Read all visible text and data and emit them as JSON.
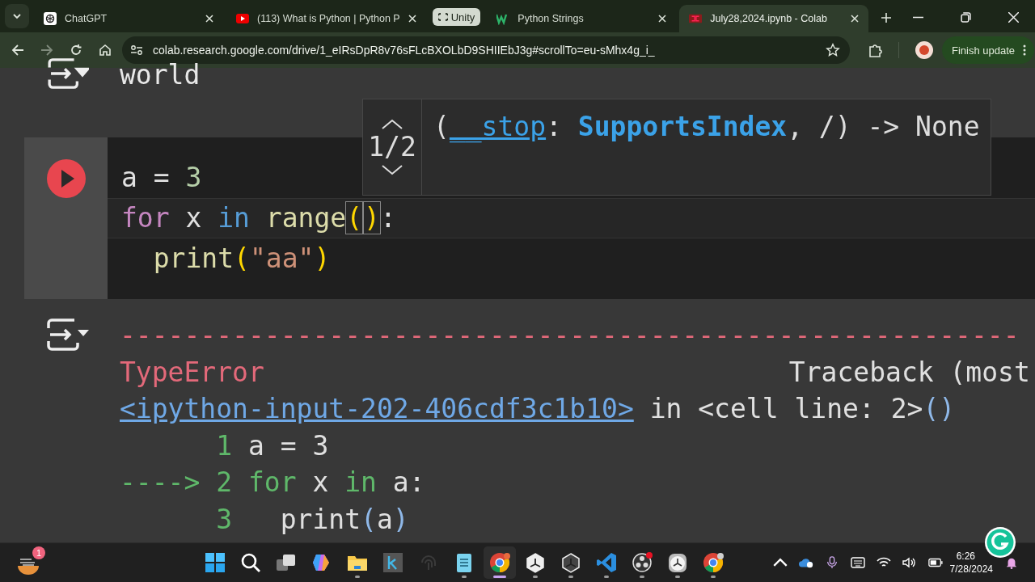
{
  "browser": {
    "tabs": [
      {
        "kind": "tab",
        "label": "ChatGPT",
        "selected": false
      },
      {
        "kind": "tab",
        "label": "(113) What is Python | Python P",
        "selected": false
      },
      {
        "kind": "group",
        "label": "Unity"
      },
      {
        "kind": "tab",
        "label": "Python Strings",
        "selected": false
      },
      {
        "kind": "tab",
        "label": "July28,2024.ipynb - Colab",
        "selected": true
      }
    ],
    "url": "colab.research.google.com/drive/1_eIRsDpR8v76sFLcBXOLbD9SHIIEbJ3g#scrollTo=eu-sMhx4g_i_",
    "update_button": "Finish update"
  },
  "notebook": {
    "previous_output": "world",
    "code_cell": {
      "lines": [
        [
          {
            "kind": "plain",
            "text": "a = "
          },
          {
            "kind": "number",
            "text": "3"
          }
        ],
        [
          {
            "kind": "keyword",
            "text": "for"
          },
          {
            "kind": "plain",
            "text": " x "
          },
          {
            "kind": "operator",
            "text": "in"
          },
          {
            "kind": "function",
            "text": " range"
          },
          {
            "kind": "bracket-match",
            "text": "("
          },
          {
            "kind": "caret"
          },
          {
            "kind": "bracket-match",
            "text": ")"
          },
          {
            "kind": "plain",
            "text": ":"
          }
        ],
        [
          {
            "kind": "indent"
          },
          {
            "kind": "function",
            "text": "print"
          },
          {
            "kind": "paren",
            "text": "("
          },
          {
            "kind": "string",
            "text": "\"aa\""
          },
          {
            "kind": "paren",
            "text": ")"
          }
        ]
      ]
    },
    "signature_hint": {
      "counter": "1/2",
      "signature": [
        {
          "kind": "plain",
          "text": "("
        },
        {
          "kind": "param",
          "text": "__stop"
        },
        {
          "kind": "plain",
          "text": ": "
        },
        {
          "kind": "type",
          "text": "SupportsIndex"
        },
        {
          "kind": "plain",
          "text": ", /) -> None"
        }
      ]
    },
    "output_lines": [
      [
        {
          "kind": "error",
          "text": "--------------------------------------------------------"
        }
      ],
      [
        {
          "kind": "error",
          "text": "TypeError"
        },
        {
          "kind": "far",
          "text": "Traceback (most"
        }
      ],
      [
        {
          "kind": "link",
          "text": "<ipython-input-202-406cdf3c1b10>"
        },
        {
          "kind": "plain",
          "text": " in <cell line: 2>"
        },
        {
          "kind": "blue",
          "text": "()"
        }
      ],
      [
        {
          "kind": "indent"
        },
        {
          "kind": "green",
          "text": "1"
        },
        {
          "kind": "plain",
          "text": " a = 3"
        }
      ],
      [
        {
          "kind": "green",
          "text": "---->"
        },
        {
          "kind": "green",
          "text": " 2"
        },
        {
          "kind": "green",
          "text": " for"
        },
        {
          "kind": "plain",
          "text": " x "
        },
        {
          "kind": "green",
          "text": "in"
        },
        {
          "kind": "plain",
          "text": " a:"
        }
      ],
      [
        {
          "kind": "indent"
        },
        {
          "kind": "green",
          "text": "3"
        },
        {
          "kind": "plain",
          "text": "   print"
        },
        {
          "kind": "blue",
          "text": "("
        },
        {
          "kind": "plain",
          "text": "a"
        },
        {
          "kind": "blue",
          "text": ")"
        }
      ]
    ]
  },
  "taskbar": {
    "widget_badge": "1",
    "apps": [
      {
        "kind": "start",
        "running": false,
        "active": false
      },
      {
        "kind": "search",
        "running": false,
        "active": false
      },
      {
        "kind": "task-view",
        "running": false,
        "active": false
      },
      {
        "kind": "copilot",
        "running": false,
        "active": false
      },
      {
        "kind": "folder",
        "running": true,
        "active": false
      },
      {
        "kind": "k-app",
        "running": false,
        "active": false
      },
      {
        "kind": "fingerprint",
        "running": false,
        "active": false
      },
      {
        "kind": "notepad",
        "running": true,
        "active": false
      },
      {
        "kind": "chrome",
        "running": true,
        "active": true
      },
      {
        "kind": "unity",
        "running": true,
        "active": false
      },
      {
        "kind": "unity-dark",
        "running": true,
        "active": false
      },
      {
        "kind": "vscode",
        "running": true,
        "active": false
      },
      {
        "kind": "obs",
        "running": true,
        "active": false
      },
      {
        "kind": "clock",
        "running": true,
        "active": false
      },
      {
        "kind": "chrome-profile",
        "running": true,
        "active": false
      }
    ],
    "time": "6:26",
    "date": "7/28/2024"
  }
}
